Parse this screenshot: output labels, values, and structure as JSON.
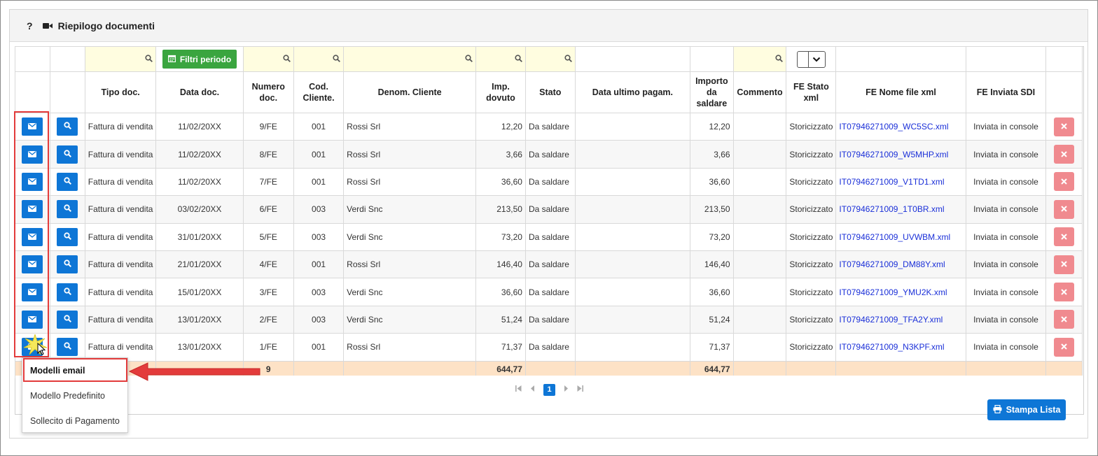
{
  "panel": {
    "help": "?",
    "title": "Riepilogo documenti"
  },
  "filters": {
    "period_button": "Filtri periodo"
  },
  "columns": [
    "Tipo doc.",
    "Data doc.",
    "Numero doc.",
    "Cod. Cliente.",
    "Denom. Cliente",
    "Imp. dovuto",
    "Stato",
    "Data ultimo pagam.",
    "Importo da saldare",
    "Commento",
    "FE Stato xml",
    "FE Nome file xml",
    "FE Inviata SDI"
  ],
  "rows": [
    {
      "tipo": "Fattura di vendita",
      "data": "11/02/20XX",
      "numero": "9/FE",
      "cod": "001",
      "cliente": "Rossi Srl",
      "imp": "12,20",
      "stato": "Da saldare",
      "pagam": "",
      "saldare": "12,20",
      "commento": "",
      "fe_stato": "Storicizzato",
      "fe_file": "IT07946271009_WC5SC.xml",
      "fe_sdi": "Inviata in console"
    },
    {
      "tipo": "Fattura di vendita",
      "data": "11/02/20XX",
      "numero": "8/FE",
      "cod": "001",
      "cliente": "Rossi Srl",
      "imp": "3,66",
      "stato": "Da saldare",
      "pagam": "",
      "saldare": "3,66",
      "commento": "",
      "fe_stato": "Storicizzato",
      "fe_file": "IT07946271009_W5MHP.xml",
      "fe_sdi": "Inviata in console"
    },
    {
      "tipo": "Fattura di vendita",
      "data": "11/02/20XX",
      "numero": "7/FE",
      "cod": "001",
      "cliente": "Rossi Srl",
      "imp": "36,60",
      "stato": "Da saldare",
      "pagam": "",
      "saldare": "36,60",
      "commento": "",
      "fe_stato": "Storicizzato",
      "fe_file": "IT07946271009_V1TD1.xml",
      "fe_sdi": "Inviata in console"
    },
    {
      "tipo": "Fattura di vendita",
      "data": "03/02/20XX",
      "numero": "6/FE",
      "cod": "003",
      "cliente": "Verdi Snc",
      "imp": "213,50",
      "stato": "Da saldare",
      "pagam": "",
      "saldare": "213,50",
      "commento": "",
      "fe_stato": "Storicizzato",
      "fe_file": "IT07946271009_1T0BR.xml",
      "fe_sdi": "Inviata in console"
    },
    {
      "tipo": "Fattura di vendita",
      "data": "31/01/20XX",
      "numero": "5/FE",
      "cod": "003",
      "cliente": "Verdi Snc",
      "imp": "73,20",
      "stato": "Da saldare",
      "pagam": "",
      "saldare": "73,20",
      "commento": "",
      "fe_stato": "Storicizzato",
      "fe_file": "IT07946271009_UVWBM.xml",
      "fe_sdi": "Inviata in console"
    },
    {
      "tipo": "Fattura di vendita",
      "data": "21/01/20XX",
      "numero": "4/FE",
      "cod": "001",
      "cliente": "Rossi Srl",
      "imp": "146,40",
      "stato": "Da saldare",
      "pagam": "",
      "saldare": "146,40",
      "commento": "",
      "fe_stato": "Storicizzato",
      "fe_file": "IT07946271009_DM88Y.xml",
      "fe_sdi": "Inviata in console"
    },
    {
      "tipo": "Fattura di vendita",
      "data": "15/01/20XX",
      "numero": "3/FE",
      "cod": "003",
      "cliente": "Verdi Snc",
      "imp": "36,60",
      "stato": "Da saldare",
      "pagam": "",
      "saldare": "36,60",
      "commento": "",
      "fe_stato": "Storicizzato",
      "fe_file": "IT07946271009_YMU2K.xml",
      "fe_sdi": "Inviata in console"
    },
    {
      "tipo": "Fattura di vendita",
      "data": "13/01/20XX",
      "numero": "2/FE",
      "cod": "003",
      "cliente": "Verdi Snc",
      "imp": "51,24",
      "stato": "Da saldare",
      "pagam": "",
      "saldare": "51,24",
      "commento": "",
      "fe_stato": "Storicizzato",
      "fe_file": "IT07946271009_TFA2Y.xml",
      "fe_sdi": "Inviata in console"
    },
    {
      "tipo": "Fattura di vendita",
      "data": "13/01/20XX",
      "numero": "1/FE",
      "cod": "001",
      "cliente": "Rossi Srl",
      "imp": "71,37",
      "stato": "Da saldare",
      "pagam": "",
      "saldare": "71,37",
      "commento": "",
      "fe_stato": "Storicizzato",
      "fe_file": "IT07946271009_N3KPF.xml",
      "fe_sdi": "Inviata in console"
    }
  ],
  "totals": {
    "count": "9",
    "imp": "644,77",
    "saldare": "644,77"
  },
  "pager": {
    "current": "1"
  },
  "menu": {
    "title": "Modelli email",
    "items": [
      "Modello Predefinito",
      "Sollecito di Pagamento"
    ]
  },
  "print_button": "Stampa Lista",
  "colors": {
    "primary": "#0e76d6",
    "danger": "#f08a8f",
    "success": "#3aa53f",
    "total_row": "#fde2c6",
    "filter_bg": "#fffde0",
    "annotation": "#e33b3b"
  }
}
